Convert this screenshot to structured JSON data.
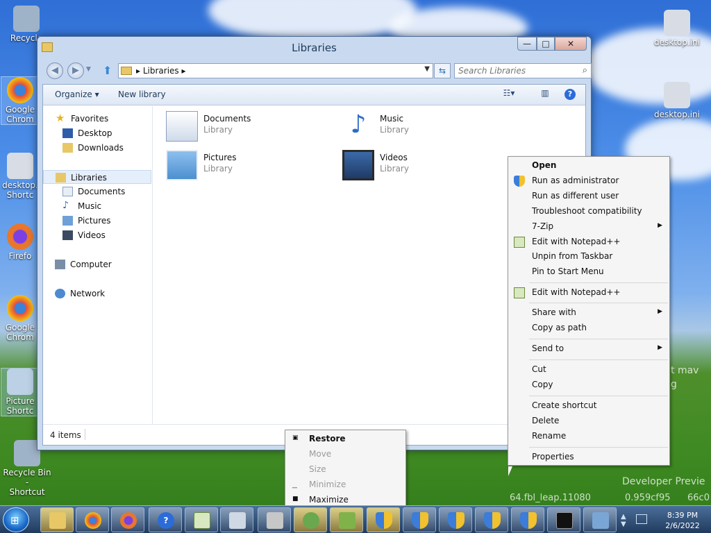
{
  "desktop": {
    "icons": [
      {
        "label": "Recycle",
        "label2": "",
        "color": "#9fb3c8"
      },
      {
        "label": "Google",
        "label2": "Chrom",
        "color": "#3b82d8"
      },
      {
        "label": "desktop.",
        "label2": "Shortc",
        "color": "#d8dde5"
      },
      {
        "label": "Firefo",
        "label2": "",
        "color": "#e8762c"
      },
      {
        "label": "Google",
        "label2": "Chrom",
        "color": "#3b82d8"
      },
      {
        "label": "Picture",
        "label2": "Shortc",
        "color": "#bcd0e6"
      },
      {
        "label": "Recycle Bin -",
        "label2": "Shortcut",
        "color": "#9fb3c8"
      },
      {
        "label": "desktop.ini",
        "label2": "",
        "color": "#d8dde5"
      },
      {
        "label": "desktop.ini",
        "label2": "",
        "color": "#d8dde5"
      }
    ],
    "bg_text": [
      "Developer Previe",
      "64.fbl_leap.11080",
      "0.959cf95",
      "66c0",
      "t mav",
      "g"
    ]
  },
  "window": {
    "title": "Libraries",
    "address": {
      "crumb": "Libraries"
    },
    "search": {
      "placeholder": "Search Libraries"
    },
    "controls": {
      "minimize": "—",
      "maximize": "□",
      "close": "✕"
    },
    "commands": {
      "organize": "Organize ▾",
      "new_library": "New library",
      "help": "?"
    },
    "nav": {
      "favorites": "Favorites",
      "desktop": "Desktop",
      "downloads": "Downloads",
      "libraries": "Libraries",
      "documents": "Documents",
      "music": "Music",
      "pictures": "Pictures",
      "videos": "Videos",
      "computer": "Computer",
      "network": "Network"
    },
    "libraries": [
      {
        "name": "Documents",
        "type": "Library"
      },
      {
        "name": "Music",
        "type": "Library"
      },
      {
        "name": "Pictures",
        "type": "Library"
      },
      {
        "name": "Videos",
        "type": "Library"
      }
    ],
    "status": "4 items"
  },
  "context_menu": {
    "items": [
      {
        "label": "Open",
        "bold": true
      },
      {
        "label": "Run as administrator",
        "icon": "uac-shield-icon"
      },
      {
        "label": "Run as different user"
      },
      {
        "label": "Troubleshoot compatibility"
      },
      {
        "label": "7-Zip",
        "submenu": true
      },
      {
        "label": "Edit with Notepad++",
        "icon": "notepad-plus-plus-icon"
      },
      {
        "label": "Unpin from Taskbar"
      },
      {
        "label": "Pin to Start Menu"
      },
      {
        "label": "Edit with Notepad++",
        "icon": "notepad-plus-plus-icon"
      },
      {
        "label": "Share with",
        "submenu": true
      },
      {
        "label": "Copy as path"
      },
      {
        "label": "Send to",
        "submenu": true
      },
      {
        "label": "Cut"
      },
      {
        "label": "Copy"
      },
      {
        "label": "Create shortcut"
      },
      {
        "label": "Delete"
      },
      {
        "label": "Rename"
      },
      {
        "label": "Properties"
      }
    ]
  },
  "system_menu": {
    "items": [
      {
        "label": "Restore",
        "bold": true
      },
      {
        "label": "Move",
        "disabled": true
      },
      {
        "label": "Size",
        "disabled": true
      },
      {
        "label": "Minimize",
        "disabled": true
      },
      {
        "label": "Maximize"
      }
    ]
  },
  "taskbar": {
    "buttons": [
      {
        "name": "explorer",
        "color": "#e8c766"
      },
      {
        "name": "chrome",
        "color": "#3b82d8"
      },
      {
        "name": "firefox",
        "color": "#e8762c"
      },
      {
        "name": "help",
        "color": "#2b6cd8"
      },
      {
        "name": "notepad-plus-plus",
        "color": "#8bc34a"
      },
      {
        "name": "calculator",
        "color": "#cfd8e3"
      },
      {
        "name": "install",
        "color": "#c7c7c7"
      },
      {
        "name": "gecko",
        "color": "#6aa84f"
      },
      {
        "name": "app",
        "color": "#7fb34a"
      },
      {
        "name": "uac-1",
        "color": "#f2c12e"
      },
      {
        "name": "uac-2",
        "color": "#f2c12e"
      },
      {
        "name": "uac-3",
        "color": "#f2c12e"
      },
      {
        "name": "uac-4",
        "color": "#f2c12e"
      },
      {
        "name": "uac-5",
        "color": "#f2c12e"
      },
      {
        "name": "cmd",
        "color": "#111111"
      },
      {
        "name": "remote-desktop",
        "color": "#7aa6d6"
      }
    ],
    "clock": {
      "time": "8:39 PM",
      "date": "2/6/2022"
    }
  }
}
